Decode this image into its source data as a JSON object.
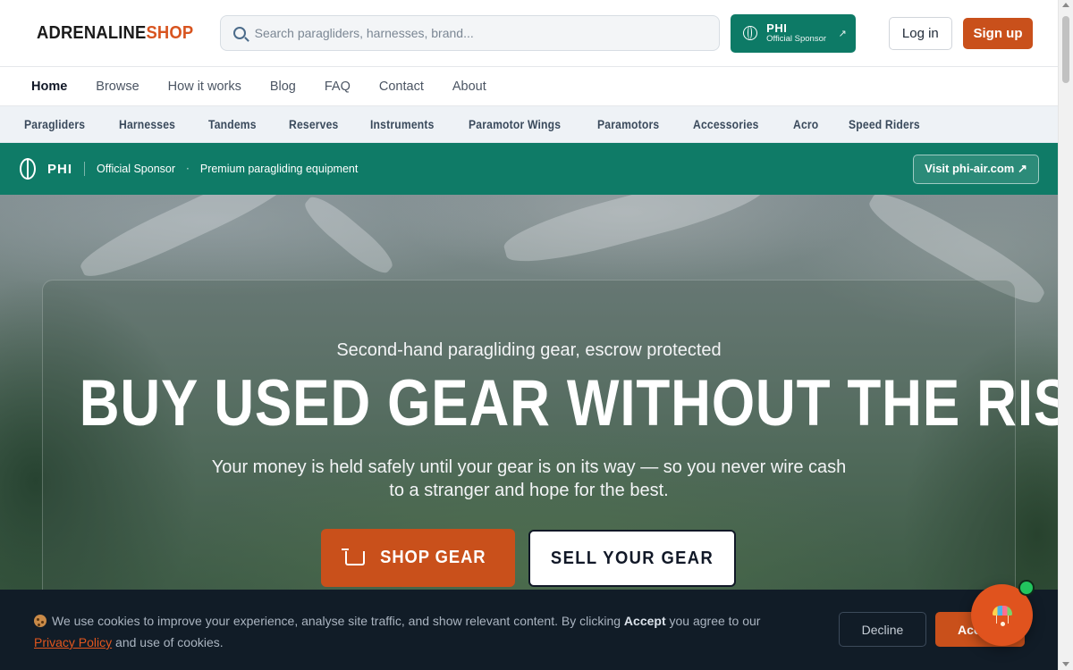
{
  "header": {
    "logo_part1": "ADRENALINE",
    "logo_part2": "SHOP",
    "search_placeholder": "Search paragliders, harnesses, brand...",
    "sponsor_name": "PHI",
    "sponsor_label": "Official Sponsor",
    "sponsor_arrow": "↗",
    "login_label": "Log in",
    "signup_label": "Sign up"
  },
  "primary_nav": [
    {
      "label": "Home",
      "active": true
    },
    {
      "label": "Browse"
    },
    {
      "label": "How it works"
    },
    {
      "label": "Blog"
    },
    {
      "label": "FAQ"
    },
    {
      "label": "Contact"
    },
    {
      "label": "About"
    }
  ],
  "categories": [
    "Paragliders",
    "Harnesses",
    "Tandems",
    "Reserves",
    "Instruments",
    "Paramotor Wings",
    "Paramotors",
    "Accessories",
    "Acro",
    "Speed Riders"
  ],
  "sponsor_banner": {
    "brand": "PHI",
    "official": "Official Sponsor",
    "dot": "·",
    "tagline": "Premium paragliding equipment",
    "cta": "Visit phi-air.com ↗"
  },
  "hero": {
    "kicker": "Second-hand paragliding gear, escrow protected",
    "title": "BUY USED GEAR WITHOUT THE RISK",
    "desc_line1": "Your money is held safely until your gear is on its way — so you never wire cash",
    "desc_line2": "to a stranger and hope for the best.",
    "shop_label": "SHOP GEAR",
    "sell_label": "SELL YOUR GEAR"
  },
  "cookie": {
    "text_before": "We use cookies to improve your experience, analyse site traffic, and show relevant content. By clicking ",
    "accept_word": "Accept",
    "text_mid": " you agree to our ",
    "privacy_label": "Privacy Policy",
    "text_after": " and use of cookies.",
    "decline_label": "Decline",
    "accept_label": "Accept"
  },
  "colors": {
    "brand_orange": "#c9501b",
    "sponsor_green": "#0f7b67",
    "cookie_bg": "#111c27"
  }
}
